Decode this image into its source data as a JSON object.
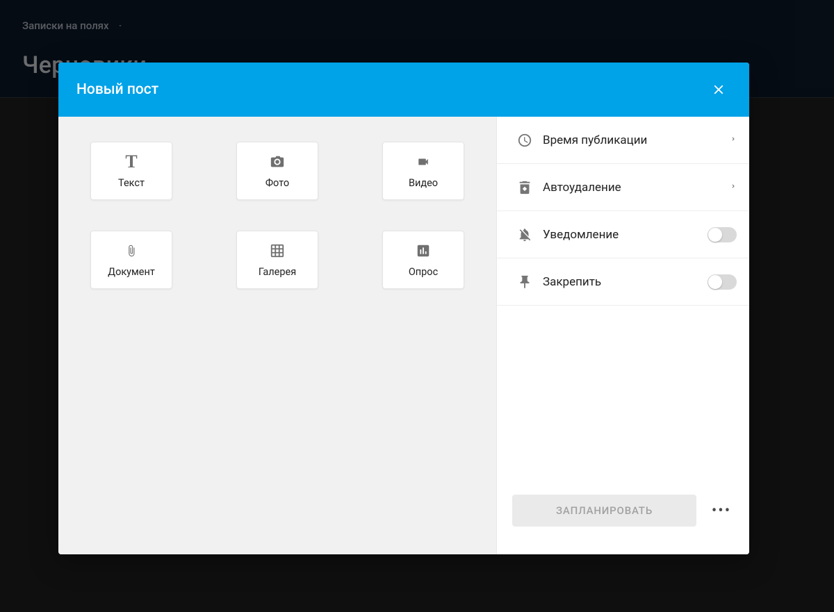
{
  "colors": {
    "accent": "#00a2e8",
    "page_top_bg": "#0f1c2e"
  },
  "page": {
    "nav_title": "Записки на полях",
    "title_partial": "Черновики"
  },
  "modal": {
    "title": "Новый пост",
    "tiles": [
      {
        "key": "text",
        "label": "Текст",
        "icon": "title-icon"
      },
      {
        "key": "photo",
        "label": "Фото",
        "icon": "camera-icon"
      },
      {
        "key": "video",
        "label": "Видео",
        "icon": "video-icon"
      },
      {
        "key": "document",
        "label": "Документ",
        "icon": "attachment-icon"
      },
      {
        "key": "gallery",
        "label": "Галерея",
        "icon": "grid-icon"
      },
      {
        "key": "poll",
        "label": "Опрос",
        "icon": "poll-icon"
      }
    ],
    "settings": [
      {
        "key": "publish_time",
        "label": "Время публикации",
        "icon": "clock-icon",
        "type": "arrow"
      },
      {
        "key": "auto_delete",
        "label": "Автоудаление",
        "icon": "auto-delete-icon",
        "type": "arrow"
      },
      {
        "key": "notify",
        "label": "Уведомление",
        "icon": "bell-off-icon",
        "type": "toggle",
        "value": false
      },
      {
        "key": "pin",
        "label": "Закрепить",
        "icon": "pin-icon",
        "type": "toggle",
        "value": false
      }
    ],
    "schedule_button": "ЗАПЛАНИРОВАТЬ"
  }
}
